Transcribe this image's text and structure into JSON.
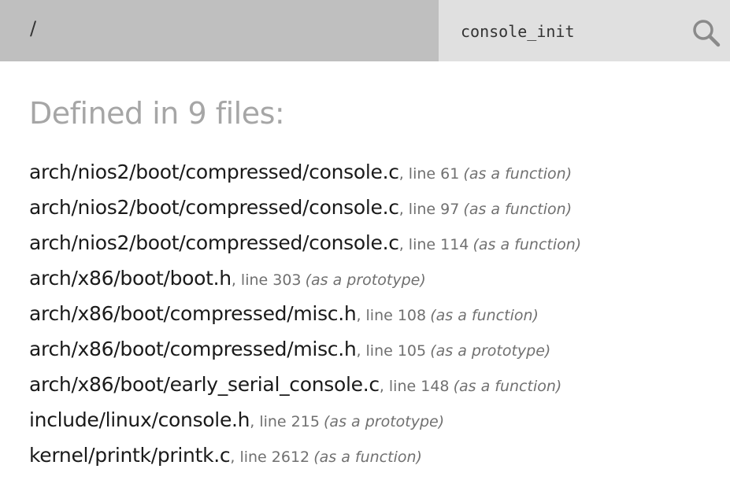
{
  "header": {
    "path": "/",
    "search": {
      "value": "console_init",
      "icon": "search-icon"
    }
  },
  "main": {
    "heading": "Defined in 9 files:",
    "results": [
      {
        "file": "arch/nios2/boot/compressed/console.c",
        "line": ", line 61",
        "kind": "(as a function)"
      },
      {
        "file": "arch/nios2/boot/compressed/console.c",
        "line": ", line 97",
        "kind": "(as a function)"
      },
      {
        "file": "arch/nios2/boot/compressed/console.c",
        "line": ", line 114",
        "kind": "(as a function)"
      },
      {
        "file": "arch/x86/boot/boot.h",
        "line": ", line 303",
        "kind": "(as a prototype)"
      },
      {
        "file": "arch/x86/boot/compressed/misc.h",
        "line": ", line 108",
        "kind": "(as a function)"
      },
      {
        "file": "arch/x86/boot/compressed/misc.h",
        "line": ", line 105",
        "kind": "(as a prototype)"
      },
      {
        "file": "arch/x86/boot/early_serial_console.c",
        "line": ", line 148",
        "kind": "(as a function)"
      },
      {
        "file": "include/linux/console.h",
        "line": ", line 215",
        "kind": "(as a prototype)"
      },
      {
        "file": "kernel/printk/printk.c",
        "line": ", line 2612",
        "kind": "(as a function)"
      }
    ]
  },
  "colors": {
    "path_bar": "#bfbfbf",
    "search_bar": "#e0e0e0",
    "heading": "#a6a6a6",
    "link": "#1a1a1a",
    "meta": "#707070"
  }
}
